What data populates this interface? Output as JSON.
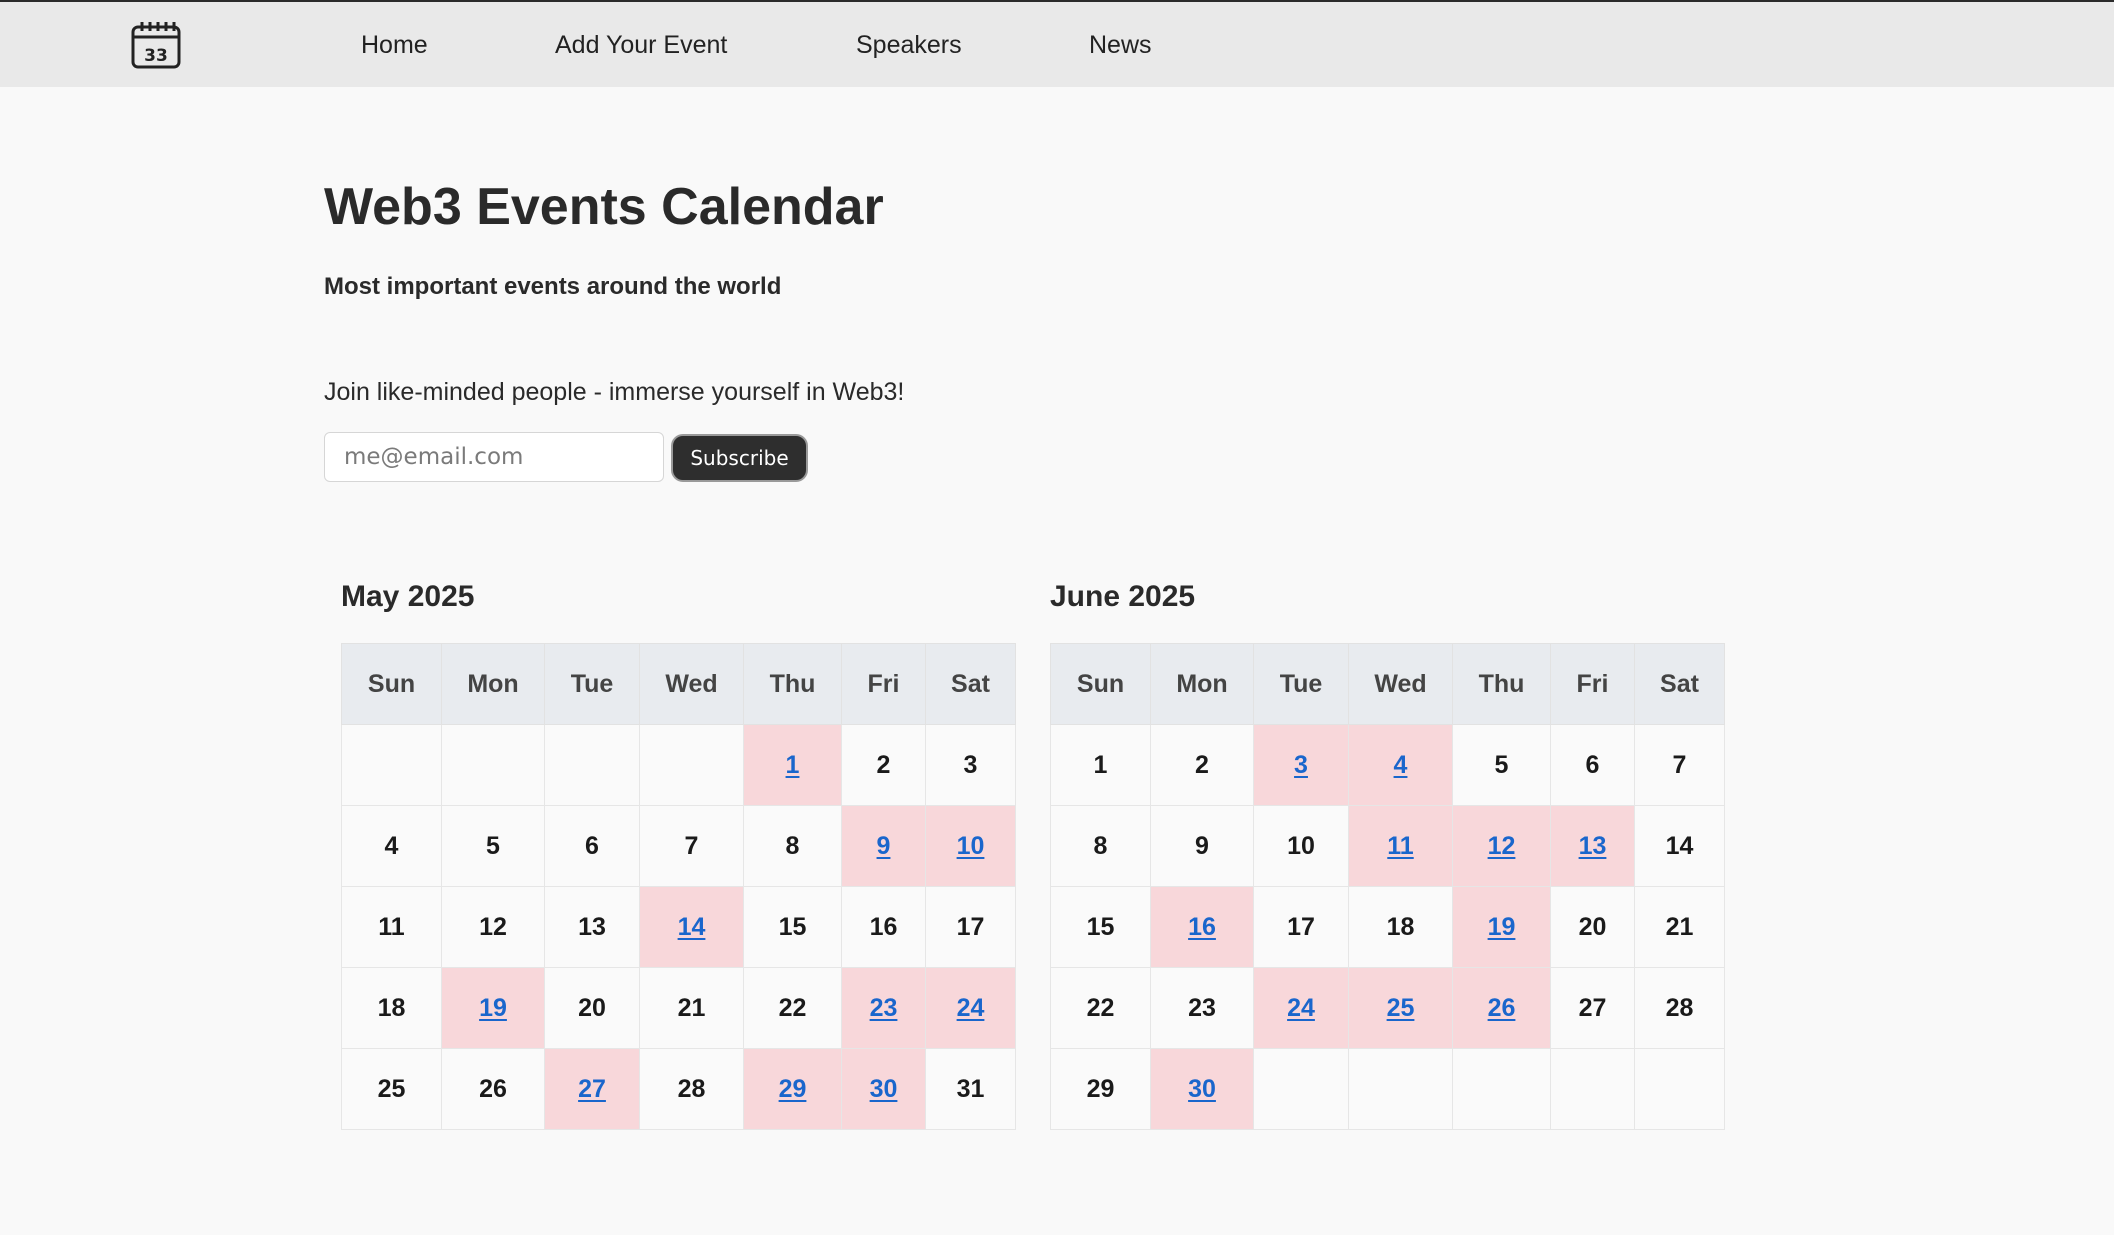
{
  "nav": {
    "logo_icon": "calendar-icon",
    "links": [
      "Home",
      "Add Your Event",
      "Speakers",
      "News"
    ]
  },
  "header": {
    "title": "Web3 Events Calendar",
    "subtitle": "Most important events around the world"
  },
  "subscribe": {
    "text": "Join like-minded people - immerse yourself in Web3!",
    "email_placeholder": "me@email.com",
    "button_label": "Subscribe"
  },
  "colors": {
    "event_day_bg": "#f8d7da",
    "event_link": "#1a66cc",
    "header_bg": "#e8ebef",
    "nav_bg": "#e9e9e9"
  },
  "calendars": [
    {
      "title": "May 2025",
      "weekdays": [
        "Sun",
        "Mon",
        "Tue",
        "Wed",
        "Thu",
        "Fri",
        "Sat"
      ],
      "first_weekday": 4,
      "days_in_month": 31,
      "event_days": [
        1,
        9,
        10,
        14,
        19,
        23,
        24,
        27,
        29,
        30
      ]
    },
    {
      "title": "June 2025",
      "weekdays": [
        "Sun",
        "Mon",
        "Tue",
        "Wed",
        "Thu",
        "Fri",
        "Sat"
      ],
      "first_weekday": 0,
      "days_in_month": 30,
      "event_days": [
        3,
        4,
        11,
        12,
        13,
        16,
        19,
        24,
        25,
        26,
        30
      ]
    }
  ]
}
